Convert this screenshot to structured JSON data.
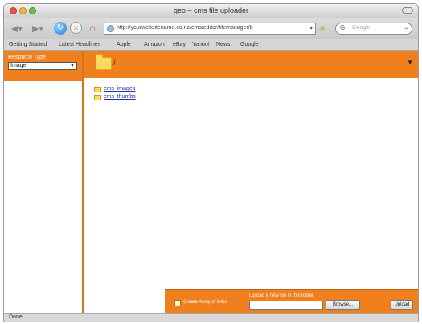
{
  "window": {
    "title": "geo – cms file uploader"
  },
  "nav": {
    "back_icon": "back-arrow-icon",
    "forward_icon": "forward-arrow-icon",
    "url": "http://yourwebsitename.co.nz/cms/editor/filemanager/b",
    "search_engine": "G",
    "search_placeholder": "Google"
  },
  "bookmarks": [
    "Getting Started",
    "Latest Headlines",
    "Apple",
    "Amazon",
    "eBay",
    "Yahoo!",
    "News",
    "Google"
  ],
  "sidebar": {
    "resource_type_label": "Resource Type",
    "resource_type_value": "Image"
  },
  "main": {
    "path": "/",
    "folders": [
      "cms_images",
      "cms_thumbs"
    ]
  },
  "footer": {
    "checkbox_label": "Create Array of links",
    "upload_label": "Upload a new file in this folder",
    "browse_label": "Browse...",
    "upload_button": "Upload"
  },
  "status": {
    "text": "Done"
  },
  "colors": {
    "accent_orange": "#f07f1d",
    "link_blue": "#2233aa"
  }
}
